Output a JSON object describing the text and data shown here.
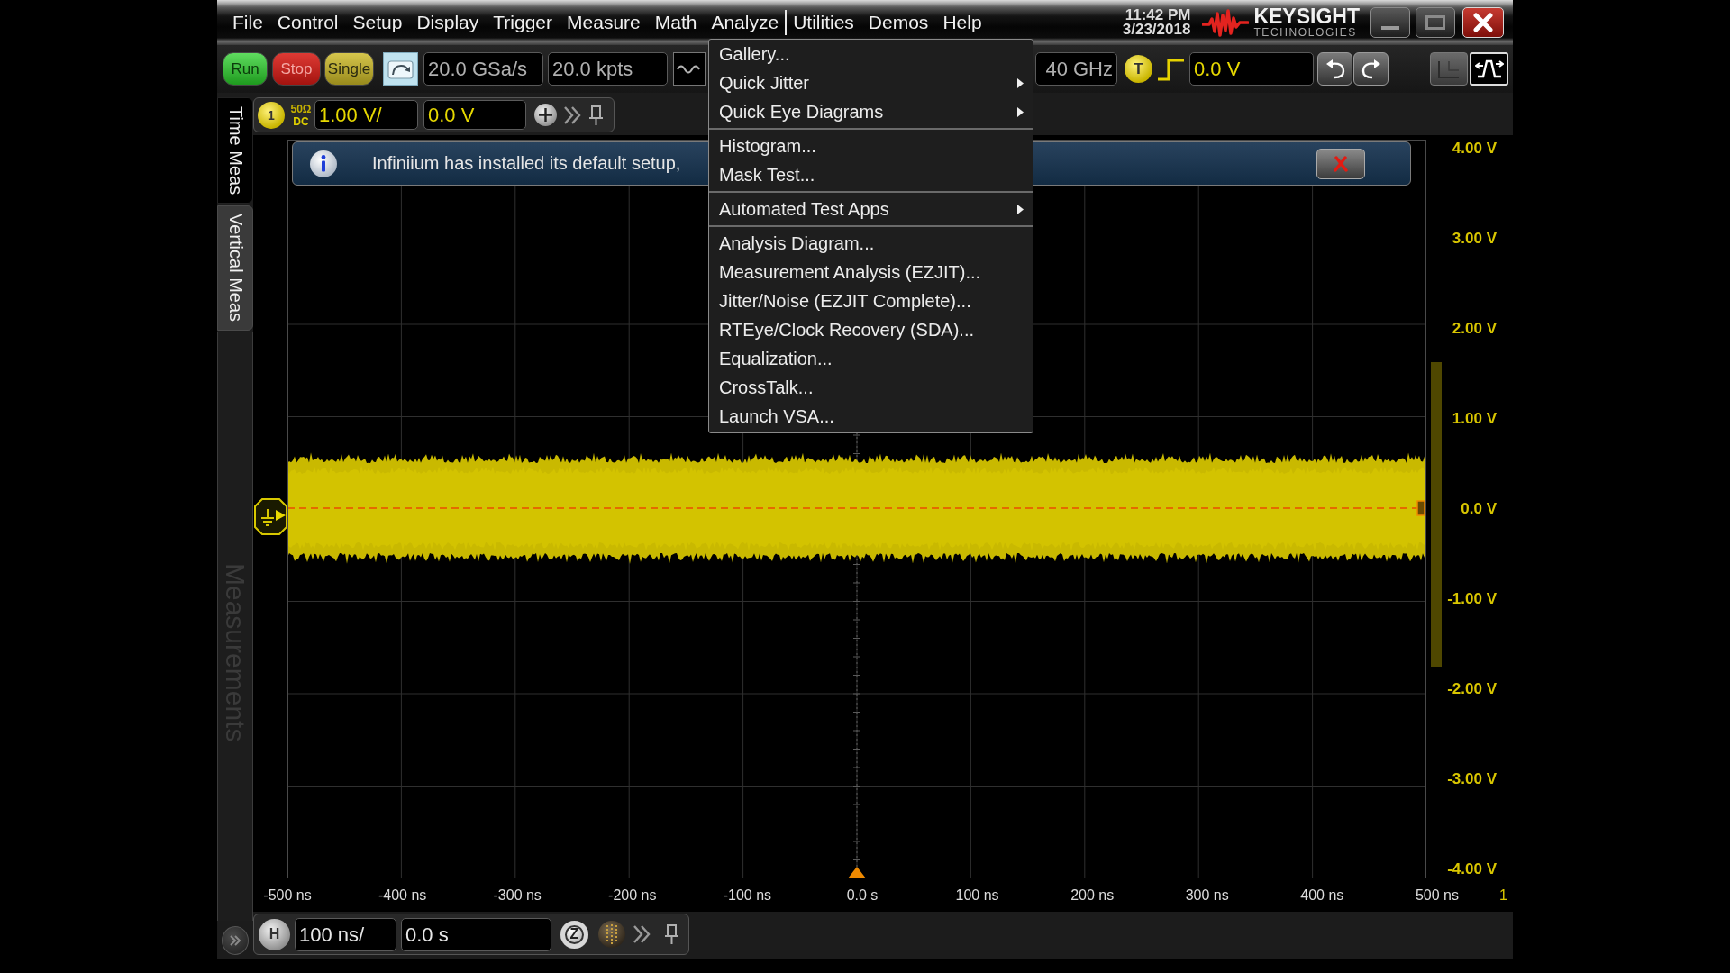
{
  "title_bar": {
    "menu": [
      {
        "label": "File",
        "selected": false
      },
      {
        "label": "Control",
        "selected": false
      },
      {
        "label": "Setup",
        "selected": false
      },
      {
        "label": "Display",
        "selected": false
      },
      {
        "label": "Trigger",
        "selected": false
      },
      {
        "label": "Measure",
        "selected": false
      },
      {
        "label": "Math",
        "selected": false
      },
      {
        "label": "Analyze",
        "selected": true
      },
      {
        "label": "Utilities",
        "selected": false
      },
      {
        "label": "Demos",
        "selected": false
      },
      {
        "label": "Help",
        "selected": false
      }
    ],
    "time": "11:42 PM",
    "date": "3/23/2018",
    "logo": {
      "name": "KEYSIGHT",
      "tagline": "TECHNOLOGIES"
    }
  },
  "toolbar": {
    "acquisition_buttons": [
      {
        "label": "Run",
        "kind": "run"
      },
      {
        "label": "Stop",
        "kind": "stop"
      },
      {
        "label": "Single",
        "kind": "single"
      }
    ],
    "sample_rate": "20.0 GSa/s",
    "memory_depth": "20.0 kpts",
    "bandwidth": "40 GHz",
    "trigger": {
      "badge": "T",
      "threshold": "0.0 V"
    }
  },
  "channel": {
    "number": "1",
    "impedance": "50Ω",
    "coupling": "DC",
    "scale": "1.00 V/",
    "offset": "0.0 V"
  },
  "side_tabs": [
    {
      "label": "Time Meas",
      "selected": true
    },
    {
      "label": "Vertical Meas",
      "selected": false
    }
  ],
  "side_panel": {
    "label": "Measurements"
  },
  "notification": {
    "message": "Infiniium has installed its default setup,"
  },
  "analyze_menu": {
    "groups": [
      {
        "items": [
          {
            "label": "Gallery...",
            "submenu": false
          },
          {
            "label": "Quick Jitter",
            "submenu": true
          },
          {
            "label": "Quick Eye Diagrams",
            "submenu": true
          }
        ]
      },
      {
        "items": [
          {
            "label": "Histogram...",
            "submenu": false
          },
          {
            "label": "Mask Test...",
            "submenu": false
          }
        ]
      },
      {
        "items": [
          {
            "label": "Automated Test Apps",
            "submenu": true
          }
        ]
      },
      {
        "items": [
          {
            "label": "Analysis Diagram...",
            "submenu": false
          },
          {
            "label": "Measurement Analysis (EZJIT)...",
            "submenu": false
          },
          {
            "label": "Jitter/Noise (EZJIT Complete)...",
            "submenu": false
          },
          {
            "label": "RTEye/Clock Recovery (SDA)...",
            "submenu": false
          },
          {
            "label": "Equalization...",
            "submenu": false
          },
          {
            "label": "CrossTalk...",
            "submenu": false
          },
          {
            "label": "Launch VSA...",
            "submenu": false
          }
        ]
      }
    ]
  },
  "display": {
    "y_labels": [
      "4.00 V",
      "3.00 V",
      "2.00 V",
      "1.00 V",
      "0.0 V",
      "-1.00 V",
      "-2.00 V",
      "-3.00 V",
      "-4.00 V"
    ],
    "x_labels": [
      "-500 ns",
      "-400 ns",
      "-300 ns",
      "-200 ns",
      "-100 ns",
      "0.0 s",
      "100 ns",
      "200 ns",
      "300 ns",
      "400 ns",
      "500 ns"
    ],
    "edge_label": "1"
  },
  "timebase": {
    "badge": "H",
    "scale": "100 ns/",
    "position": "0.0 s",
    "zoom_badge": "Z"
  }
}
